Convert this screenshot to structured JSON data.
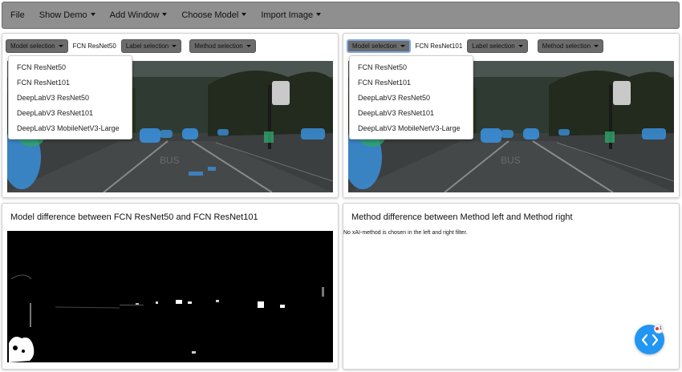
{
  "menubar": {
    "items": [
      "File",
      "Show Demo",
      "Add Window",
      "Choose Model",
      "Import Image"
    ]
  },
  "left_panel": {
    "model_button": "Model selection",
    "model_value": "FCN ResNet50",
    "label_button": "Label selection",
    "method_button": "Method selection",
    "dropdown_options": [
      "FCN ResNet50",
      "FCN ResNet101",
      "DeepLabV3 ResNet50",
      "DeepLabV3 ResNet101",
      "DeepLabV3 MobileNetV3-Large"
    ],
    "scene_label": "BUS"
  },
  "right_panel": {
    "model_button": "Model selection",
    "model_value": "FCN ResNet101",
    "label_button": "Label selection",
    "method_button": "Method selection",
    "dropdown_options": [
      "FCN ResNet50",
      "FCN ResNet101",
      "DeepLabV3 ResNet50",
      "DeepLabV3 ResNet101",
      "DeepLabV3 MobileNetV3-Large"
    ],
    "scene_label": "BUS"
  },
  "model_diff": {
    "title": "Model difference between FCN ResNet50 and FCN ResNet101"
  },
  "method_diff": {
    "title": "Method difference between Method left and Method right",
    "notice": "No xAI-method is chosen in the left and right filter."
  },
  "fab": {
    "badge": "1"
  },
  "colors": {
    "menubar": "#8f8f8f",
    "button": "#6c6c6c",
    "overlay_blue": "#3a8fd9",
    "overlay_green": "#2ea56a",
    "fab": "#2196f3"
  }
}
